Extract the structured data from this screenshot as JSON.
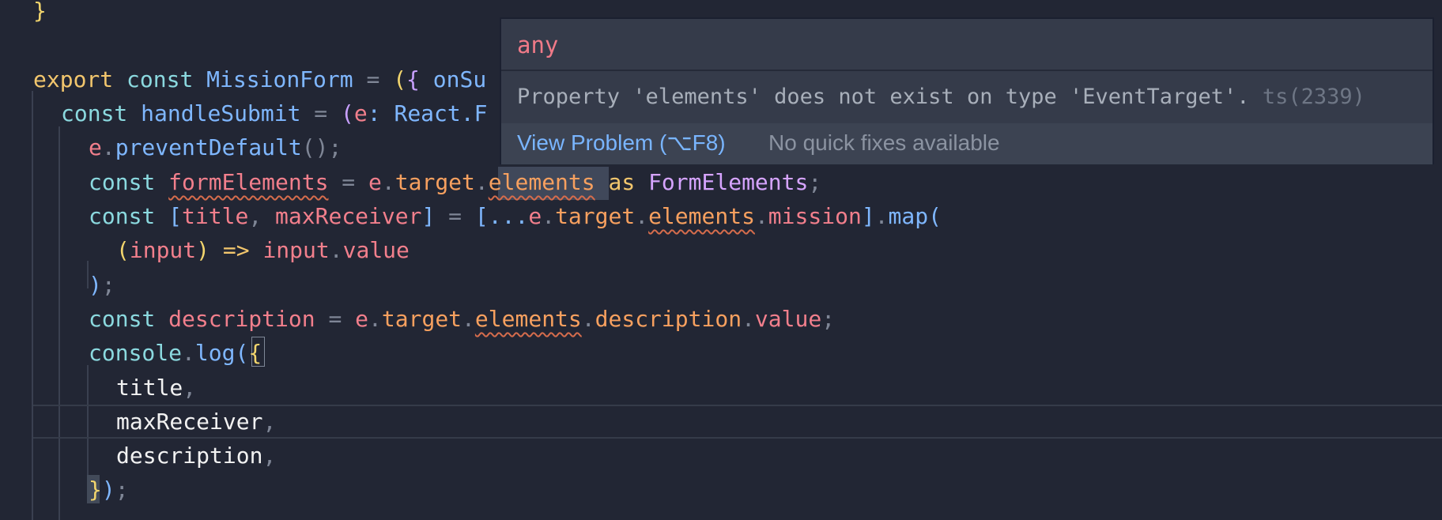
{
  "editor": {
    "lines": [
      {
        "id": "line-1",
        "tokens": [
          {
            "text": "}",
            "cls": "paren"
          }
        ]
      },
      {
        "id": "line-2",
        "tokens": [
          {
            "text": "export",
            "cls": "kw2"
          },
          {
            "text": " const ",
            "cls": "kw"
          },
          {
            "text": "MissionForm",
            "cls": "fn"
          },
          {
            "text": " = ",
            "cls": "muted"
          },
          {
            "text": "(",
            "cls": "paren"
          },
          {
            "text": "{",
            "cls": "angle"
          },
          {
            "text": " onSu",
            "cls": "fn"
          }
        ]
      },
      {
        "id": "line-3",
        "tokens": [
          {
            "text": "const ",
            "cls": "kw"
          },
          {
            "text": "handleSubmit",
            "cls": "fn"
          },
          {
            "text": " = ",
            "cls": "muted"
          },
          {
            "text": "(",
            "cls": "angle"
          },
          {
            "text": "e",
            "cls": "var"
          },
          {
            "text": ": React.F",
            "cls": "fn"
          }
        ]
      },
      {
        "id": "line-4",
        "tokens": [
          {
            "text": "e",
            "cls": "var"
          },
          {
            "text": ".",
            "cls": "muted"
          },
          {
            "text": "preventDefault",
            "cls": "fn"
          },
          {
            "text": "();",
            "cls": "muted"
          }
        ]
      },
      {
        "id": "line-5",
        "tokens": [
          {
            "text": "const ",
            "cls": "kw"
          },
          {
            "text": "formElements",
            "cls": "var squiggle"
          },
          {
            "text": " = ",
            "cls": "muted"
          },
          {
            "text": "e",
            "cls": "var"
          },
          {
            "text": ".",
            "cls": "muted"
          },
          {
            "text": "target",
            "cls": "prop"
          },
          {
            "text": ".",
            "cls": "muted"
          },
          {
            "text": "elements",
            "cls": "prop squiggle"
          },
          {
            "text": " as ",
            "cls": "kw2"
          },
          {
            "text": "FormElements",
            "cls": "type"
          },
          {
            "text": ";",
            "cls": "muted"
          }
        ]
      },
      {
        "id": "line-6",
        "tokens": [
          {
            "text": "const ",
            "cls": "kw"
          },
          {
            "text": "[",
            "cls": "fn"
          },
          {
            "text": "title",
            "cls": "var"
          },
          {
            "text": ", ",
            "cls": "muted"
          },
          {
            "text": "maxReceiver",
            "cls": "var"
          },
          {
            "text": "]",
            "cls": "fn"
          },
          {
            "text": " = ",
            "cls": "muted"
          },
          {
            "text": "[...",
            "cls": "fn"
          },
          {
            "text": "e",
            "cls": "var"
          },
          {
            "text": ".",
            "cls": "muted"
          },
          {
            "text": "target",
            "cls": "prop"
          },
          {
            "text": ".",
            "cls": "muted"
          },
          {
            "text": "elements",
            "cls": "prop squiggle"
          },
          {
            "text": ".",
            "cls": "muted"
          },
          {
            "text": "mission",
            "cls": "var"
          },
          {
            "text": "]",
            "cls": "fn"
          },
          {
            "text": ".",
            "cls": "muted"
          },
          {
            "text": "map",
            "cls": "fn"
          },
          {
            "text": "(",
            "cls": "fn"
          }
        ]
      },
      {
        "id": "line-7",
        "tokens": [
          {
            "text": "(",
            "cls": "paren"
          },
          {
            "text": "input",
            "cls": "var"
          },
          {
            "text": ") ",
            "cls": "paren"
          },
          {
            "text": "=>",
            "cls": "kw2"
          },
          {
            "text": " input",
            "cls": "var"
          },
          {
            "text": ".",
            "cls": "muted"
          },
          {
            "text": "value",
            "cls": "var"
          }
        ]
      },
      {
        "id": "line-8",
        "tokens": [
          {
            "text": ")",
            "cls": "fn"
          },
          {
            "text": ";",
            "cls": "muted"
          }
        ]
      },
      {
        "id": "line-9",
        "tokens": [
          {
            "text": "const ",
            "cls": "kw"
          },
          {
            "text": "description",
            "cls": "var"
          },
          {
            "text": " = ",
            "cls": "muted"
          },
          {
            "text": "e",
            "cls": "var"
          },
          {
            "text": ".",
            "cls": "muted"
          },
          {
            "text": "target",
            "cls": "prop"
          },
          {
            "text": ".",
            "cls": "muted"
          },
          {
            "text": "elements",
            "cls": "prop squiggle"
          },
          {
            "text": ".",
            "cls": "muted"
          },
          {
            "text": "description",
            "cls": "prop"
          },
          {
            "text": ".",
            "cls": "muted"
          },
          {
            "text": "value",
            "cls": "var"
          },
          {
            "text": ";",
            "cls": "muted"
          }
        ]
      },
      {
        "id": "line-10",
        "tokens": [
          {
            "text": "console",
            "cls": "kw"
          },
          {
            "text": ".",
            "cls": "muted"
          },
          {
            "text": "log",
            "cls": "fn"
          },
          {
            "text": "(",
            "cls": "fn"
          },
          {
            "text": "{",
            "cls": "paren"
          }
        ]
      },
      {
        "id": "line-11",
        "tokens": [
          {
            "text": "title",
            "cls": "text"
          },
          {
            "text": ",",
            "cls": "muted"
          }
        ]
      },
      {
        "id": "line-12",
        "tokens": [
          {
            "text": "maxReceiver",
            "cls": "text"
          },
          {
            "text": ",",
            "cls": "muted"
          }
        ]
      },
      {
        "id": "line-13",
        "tokens": [
          {
            "text": "description",
            "cls": "text"
          },
          {
            "text": ",",
            "cls": "muted"
          }
        ]
      },
      {
        "id": "line-14",
        "tokens": [
          {
            "text": "}",
            "cls": "paren"
          },
          {
            "text": ")",
            "cls": "fn"
          },
          {
            "text": ";",
            "cls": "muted"
          }
        ]
      }
    ]
  },
  "tooltip": {
    "type": "any",
    "message": "Property 'elements' does not exist on type 'EventTarget'.",
    "code": "ts(2339)",
    "view_problem": "View Problem (⌥F8)",
    "no_fix": "No quick fixes available"
  },
  "colors": {
    "background": "#222634",
    "tooltip_background": "#353b4a",
    "link": "#79b5ff",
    "error": "#d56c4c"
  }
}
